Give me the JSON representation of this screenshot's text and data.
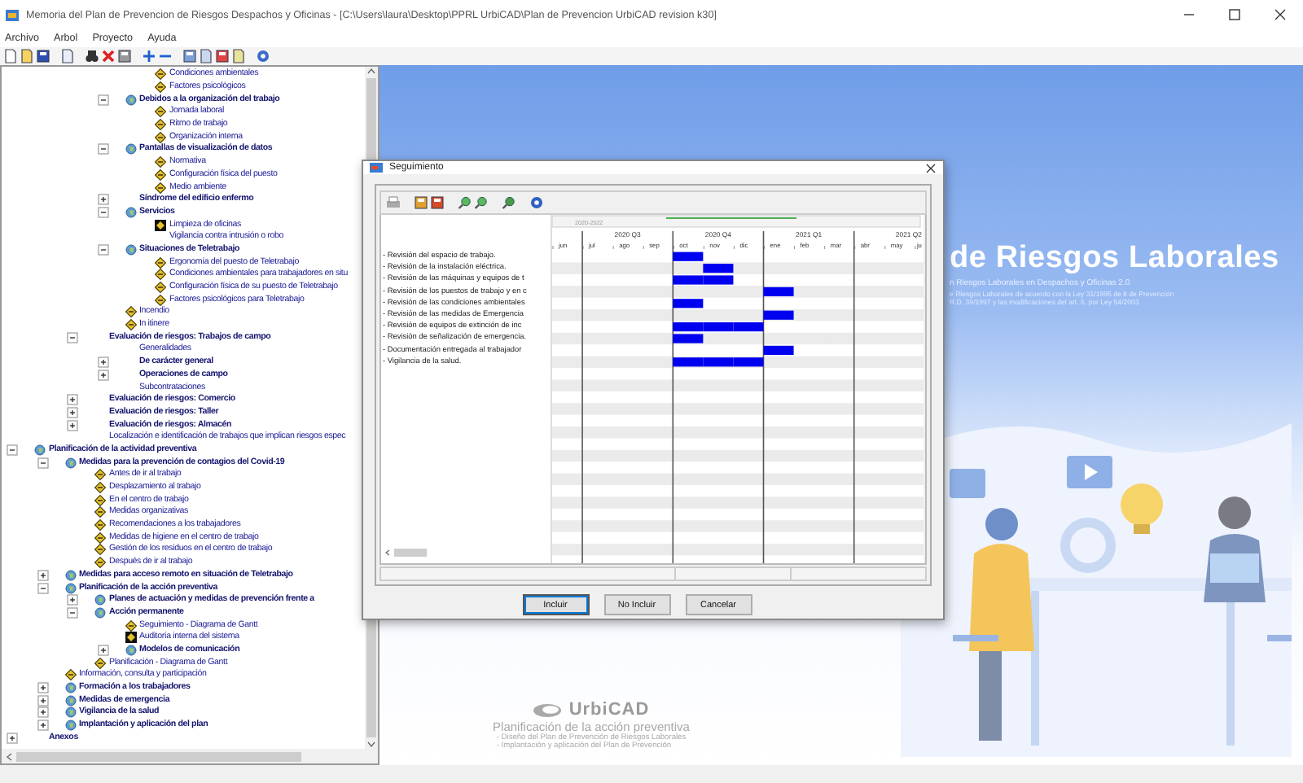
{
  "window": {
    "title": "Memoria del Plan de Prevencion de Riesgos Despachos y Oficinas - [C:\\Users\\laura\\Desktop\\PPRL UrbiCAD\\Plan de Prevencion UrbiCAD revision k30]"
  },
  "menu": [
    "Archivo",
    "Arbol",
    "Proyecto",
    "Ayuda"
  ],
  "tree": {
    "items": [
      {
        "children": [
          {
            "children": [
              {
                "children": [
                  {
                    "children": [
                      {
                        "label": "Condiciones ambientales",
                        "kind": "leaf",
                        "bold": false
                      },
                      {
                        "label": "Factores psicológicos",
                        "kind": "leaf",
                        "bold": false
                      }
                    ]
                  },
                  {
                    "label": "Debidos a la organización del trabajo",
                    "kind": "folder",
                    "bold": true,
                    "expanded": true,
                    "children": [
                      {
                        "label": "Jornada laboral",
                        "kind": "leaf",
                        "bold": false
                      },
                      {
                        "label": "Ritmo de trabajo",
                        "kind": "leaf",
                        "bold": false
                      },
                      {
                        "label": "Organización interna",
                        "kind": "leaf",
                        "bold": false
                      }
                    ]
                  },
                  {
                    "label": "Pantallas de visualización de datos",
                    "kind": "folder",
                    "bold": true,
                    "expanded": true,
                    "children": [
                      {
                        "label": "Normativa",
                        "kind": "leaf",
                        "bold": false
                      },
                      {
                        "label": "Configuración física del puesto",
                        "kind": "leaf",
                        "bold": false
                      },
                      {
                        "label": "Medio ambiente",
                        "kind": "leaf",
                        "bold": false
                      }
                    ]
                  },
                  {
                    "label": "Síndrome del edificio enfermo",
                    "kind": "none",
                    "bold": true,
                    "expanded": false
                  },
                  {
                    "label": "Servicios",
                    "kind": "folder",
                    "bold": true,
                    "expanded": true,
                    "children": [
                      {
                        "label": "Limpieza de oficinas",
                        "kind": "marked",
                        "bold": false
                      },
                      {
                        "label": "Vigilancia contra intrusión o robo",
                        "kind": "none",
                        "bold": false
                      }
                    ]
                  },
                  {
                    "label": "Situaciones de Teletrabajo",
                    "kind": "folder",
                    "bold": true,
                    "expanded": true,
                    "children": [
                      {
                        "label": "Ergonomía del puesto de Teletrabajo",
                        "kind": "leaf",
                        "bold": false
                      },
                      {
                        "label": "Condiciones ambientales para trabajadores en situ",
                        "kind": "leaf",
                        "bold": false
                      },
                      {
                        "label": "Configuración física de su puesto de Teletrabajo",
                        "kind": "leaf",
                        "bold": false
                      },
                      {
                        "label": "Factores psicológicos para Teletrabajo",
                        "kind": "leaf",
                        "bold": false
                      }
                    ]
                  },
                  {
                    "label": "Incendio",
                    "kind": "leaf",
                    "bold": false
                  },
                  {
                    "label": "In itinere",
                    "kind": "leaf",
                    "bold": false
                  }
                ]
              },
              {
                "label": "Evaluación de riesgos: Trabajos de campo",
                "kind": "none",
                "bold": true,
                "expanded": true,
                "children": [
                  {
                    "label": "Generalidades",
                    "kind": "none",
                    "bold": false
                  },
                  {
                    "label": "De carácter general",
                    "kind": "none",
                    "bold": true,
                    "expanded": false
                  },
                  {
                    "label": "Operaciones de campo",
                    "kind": "none",
                    "bold": true,
                    "expanded": false
                  },
                  {
                    "label": "Subcontrataciones",
                    "kind": "none",
                    "bold": false
                  }
                ]
              },
              {
                "label": "Evaluación de riesgos: Comercio",
                "kind": "none",
                "bold": true,
                "expanded": false
              },
              {
                "label": "Evaluación de riesgos: Taller",
                "kind": "none",
                "bold": true,
                "expanded": false
              },
              {
                "label": "Evaluación de riesgos: Almacén",
                "kind": "none",
                "bold": true,
                "expanded": false
              },
              {
                "label": "Localización e identificación de trabajos que implican riesgos espec",
                "kind": "none",
                "bold": false
              }
            ]
          }
        ]
      },
      {
        "label": "Planificación de la actividad preventiva",
        "kind": "folder",
        "bold": true,
        "expanded": true,
        "children": [
          {
            "label": "Medidas para la prevención de contagios del Covid-19",
            "kind": "folder",
            "bold": true,
            "expanded": true,
            "children": [
              {
                "label": "Antes de ir al trabajo",
                "kind": "leaf",
                "bold": false
              },
              {
                "label": "Desplazamiento al trabajo",
                "kind": "leaf",
                "bold": false
              },
              {
                "label": "En el centro de trabajo",
                "kind": "leaf",
                "bold": false
              },
              {
                "label": "Medidas organizativas",
                "kind": "leaf",
                "bold": false
              },
              {
                "label": "Recomendaciones a los trabajadores",
                "kind": "leaf",
                "bold": false
              },
              {
                "label": "Medidas de higiene en el centro de trabajo",
                "kind": "leaf",
                "bold": false
              },
              {
                "label": "Gestión de los residuos en el centro de trabajo",
                "kind": "leaf",
                "bold": false
              },
              {
                "label": "Después de ir al trabajo",
                "kind": "leaf",
                "bold": false
              }
            ]
          },
          {
            "label": "Medidas para acceso remoto en situación de Teletrabajo",
            "kind": "folder",
            "bold": true,
            "expanded": false
          },
          {
            "label": "Planificación de la acción preventiva",
            "kind": "folder",
            "bold": true,
            "expanded": true,
            "children": [
              {
                "label": "Planes de actuación y medidas de prevención frente a",
                "kind": "folder",
                "bold": true,
                "expanded": false
              },
              {
                "label": "Acción permanente",
                "kind": "folder",
                "bold": true,
                "expanded": true,
                "children": [
                  {
                    "label": "Seguimiento - Diagrama de Gantt",
                    "kind": "leaf",
                    "bold": false
                  },
                  {
                    "label": "Auditoría interna del sistema",
                    "kind": "marked",
                    "bold": false
                  },
                  {
                    "label": "Modelos de comunicación",
                    "kind": "folder",
                    "bold": true,
                    "expanded": false
                  }
                ]
              },
              {
                "label": "Planificación - Diagrama de Gantt",
                "kind": "leaf",
                "bold": false
              }
            ]
          },
          {
            "label": "Información, consulta y participación",
            "kind": "leaf",
            "bold": false
          },
          {
            "label": "Formación a los trabajadores",
            "kind": "folder",
            "bold": true,
            "expanded": false
          },
          {
            "label": "Medidas de emergencia",
            "kind": "folder",
            "bold": true,
            "expanded": false
          },
          {
            "label": "Vigilancia de la salud",
            "kind": "folder",
            "bold": true,
            "expanded": false
          },
          {
            "label": "Implantación y aplicación del plan",
            "kind": "folder",
            "bold": true,
            "expanded": false
          }
        ]
      },
      {
        "label": "Anexos",
        "kind": "none",
        "bold": true,
        "expanded": false
      }
    ]
  },
  "background": {
    "heading": "de Riesgos Laborales",
    "subtitle": "n Riesgos Laborales en Despachos y Oficinas 2.0",
    "notes": [
      "e Riesgos Laborales de acuerdo con la Ley 31/1995 de 8 de Prevención",
      "R.D. 39/1997 y las modificaciones del art. 6. por Ley 54/2003"
    ],
    "brand": "UrbiCAD",
    "tagline": "Planificación de la acción preventiva",
    "bullets": [
      "- Diseño del Plan de Prevención de Riesgos Laborales",
      "- Implantación y aplicación del Plan de Prevención"
    ]
  },
  "dialog": {
    "title": "Seguimiento",
    "range_label": "2020-2022",
    "quarters": [
      "2020 Q3",
      "2020 Q4",
      "2021 Q1",
      "2021 Q2"
    ],
    "months": [
      "jun",
      "jul",
      "ago",
      "sep",
      "oct",
      "nov",
      "dic",
      "ene",
      "feb",
      "mar",
      "abr",
      "may",
      "ju"
    ],
    "tasks": [
      {
        "label": "- Revisión del espacio de trabajo.",
        "months": [
          false,
          false,
          false,
          false,
          true,
          false,
          false,
          false,
          false,
          false,
          false,
          false,
          false
        ]
      },
      {
        "label": "- Revisión de la instalación eléctrica.",
        "months": [
          false,
          false,
          false,
          false,
          false,
          true,
          false,
          false,
          false,
          false,
          false,
          false,
          false
        ]
      },
      {
        "label": "- Revisión de las máquinas y equipos de t",
        "months": [
          false,
          false,
          false,
          false,
          true,
          true,
          false,
          false,
          false,
          false,
          false,
          false,
          false
        ]
      },
      {
        "label": "- Revisión de los puestos de trabajo y en c",
        "months": [
          false,
          false,
          false,
          false,
          false,
          false,
          false,
          true,
          false,
          false,
          false,
          false,
          false
        ]
      },
      {
        "label": "- Revisión de las condiciones ambientales",
        "months": [
          false,
          false,
          false,
          false,
          true,
          false,
          false,
          false,
          false,
          false,
          false,
          false,
          false
        ]
      },
      {
        "label": "- Revisión de las medidas de Emergencia",
        "months": [
          false,
          false,
          false,
          false,
          false,
          false,
          false,
          true,
          false,
          false,
          false,
          false,
          false
        ]
      },
      {
        "label": "- Revisión de equipos de extinción de inc",
        "months": [
          false,
          false,
          false,
          false,
          true,
          true,
          true,
          false,
          false,
          false,
          false,
          false,
          false
        ]
      },
      {
        "label": "- Revisión de señalización de emergencia.",
        "months": [
          false,
          false,
          false,
          false,
          true,
          false,
          false,
          false,
          false,
          false,
          false,
          false,
          false
        ]
      },
      {
        "label": "- Documentación entregada al trabajador",
        "months": [
          false,
          false,
          false,
          false,
          false,
          false,
          false,
          true,
          false,
          false,
          false,
          false,
          false
        ]
      },
      {
        "label": "- Vigilancia de la salud.",
        "months": [
          false,
          false,
          false,
          false,
          true,
          true,
          true,
          false,
          false,
          false,
          false,
          false,
          false
        ]
      }
    ],
    "buttons": [
      {
        "label": "Incluir",
        "default": true
      },
      {
        "label": "No Incluir",
        "default": false
      },
      {
        "label": "Cancelar",
        "default": false
      }
    ]
  }
}
